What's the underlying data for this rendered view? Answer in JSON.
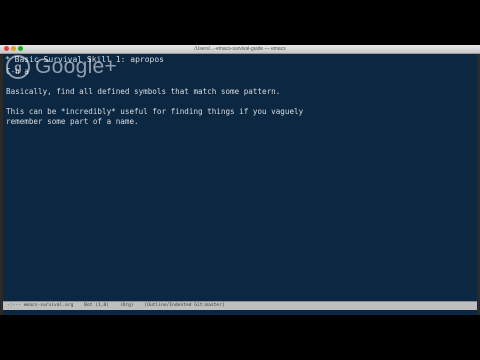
{
  "window": {
    "title": "/Users/...-emacs-survival-guide — emacs"
  },
  "editor": {
    "heading_marker": "*",
    "heading_text": "Basic Survival Skill 1: apropos",
    "lines": [
      "C-h a",
      "",
      "Basically, find all defined symbols that match some pattern.",
      "",
      "This can be *incredibly* useful for finding things if you vaguely",
      "remember some part of a name."
    ]
  },
  "modeline": {
    "segments": [
      "-:---  emacs-survival.org",
      "Bot (1,0)",
      "(Org)",
      "[Outline/Indented Git:master]"
    ]
  },
  "overlay": {
    "brand_text": "Google+",
    "brand_icon_glyph": "g"
  }
}
